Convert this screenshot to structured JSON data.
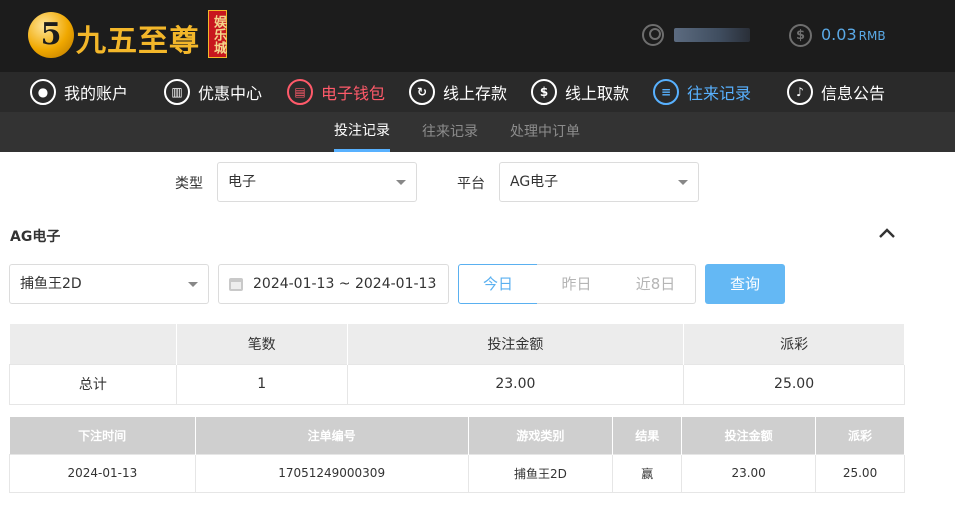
{
  "brand": {
    "name": "九五至尊",
    "mark": "5",
    "tag": "娱乐城"
  },
  "account": {
    "balance": "0.03",
    "unit": "RMB"
  },
  "nav": [
    {
      "label": "我的账户",
      "icon": "user-icon"
    },
    {
      "label": "优惠中心",
      "icon": "gift-icon"
    },
    {
      "label": "电子钱包",
      "icon": "wallet-icon"
    },
    {
      "label": "线上存款",
      "icon": "deposit-icon"
    },
    {
      "label": "线上取款",
      "icon": "withdraw-icon"
    },
    {
      "label": "往来记录",
      "icon": "record-icon"
    },
    {
      "label": "信息公告",
      "icon": "bell-icon"
    }
  ],
  "subtabs": [
    "投注记录",
    "往来记录",
    "处理中订单"
  ],
  "filters": {
    "type_label": "类型",
    "type_value": "电子",
    "platform_label": "平台",
    "platform_value": "AG电子"
  },
  "section_title": "AG电子",
  "game_select": "捕鱼王2D",
  "date_range": "2024-01-13 ~ 2024-01-13",
  "quick_dates": [
    "今日",
    "昨日",
    "近8日"
  ],
  "query_label": "查询",
  "summary": {
    "headers": [
      "",
      "笔数",
      "投注金额",
      "派彩"
    ],
    "row": [
      "总计",
      "1",
      "23.00",
      "25.00"
    ]
  },
  "detail": {
    "headers": [
      "下注时间",
      "注单编号",
      "游戏类别",
      "结果",
      "投注金额",
      "派彩"
    ],
    "rows": [
      [
        "2024-01-13",
        "17051249000309",
        "捕鱼王2D",
        "赢",
        "23.00",
        "25.00"
      ]
    ]
  },
  "colors": {
    "accent": "#58b1ff",
    "active_nav": "#ff5a6a",
    "brand_gold": "#f3b72a"
  }
}
